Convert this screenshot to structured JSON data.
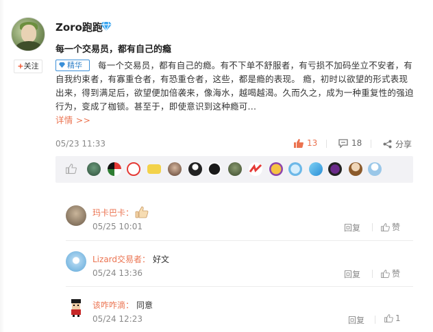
{
  "author": {
    "name": "Zoro跑跑",
    "badge_icon": "diamond-icon",
    "follow_label": "关注"
  },
  "post": {
    "title": "每一个交易员，都有自己的瘾",
    "badge_label": "精华",
    "body": "每一个交易员，都有自己的瘾。有不下单不舒服者，有亏损不加码坐立不安者，有自我约束者，有寡重仓者，有恐重仓者，这些，都是瘾的表现。 瘾，初时以欲望的形式表现出来，得到满足后，欲望便加倍袭来，像海水，越喝越渴。久而久之，成为一种重复性的强迫行为，变成了枷锁。甚至于，即使意识到这种瘾可...",
    "detail_label": "详情 >>",
    "time": "05/23 11:33",
    "like_count": "13",
    "comment_count": "18",
    "share_label": "分享"
  },
  "likers_strip": {
    "icon": "thumb-up-icon",
    "avatar_count": 15
  },
  "comments": [
    {
      "user": "玛卡巴卡",
      "colon": "：",
      "text": "",
      "emoji": "thumb-up-emoji",
      "time": "05/25 10:01",
      "reply_label": "回复",
      "like_label": "赞"
    },
    {
      "user": "Lizard交易者",
      "colon": "：",
      "text": "好文",
      "time": "05/24 13:36",
      "reply_label": "回复",
      "like_label": "赞"
    },
    {
      "user": "该咋咋滴",
      "colon": "：",
      "text": "同意",
      "time": "05/24 12:23",
      "reply_label": "回复",
      "like_label": "1"
    }
  ],
  "colors": {
    "accent": "#eb7350",
    "link_blue": "#2d7fc8",
    "muted": "#888888",
    "strip_bg": "#f2f2f5"
  }
}
